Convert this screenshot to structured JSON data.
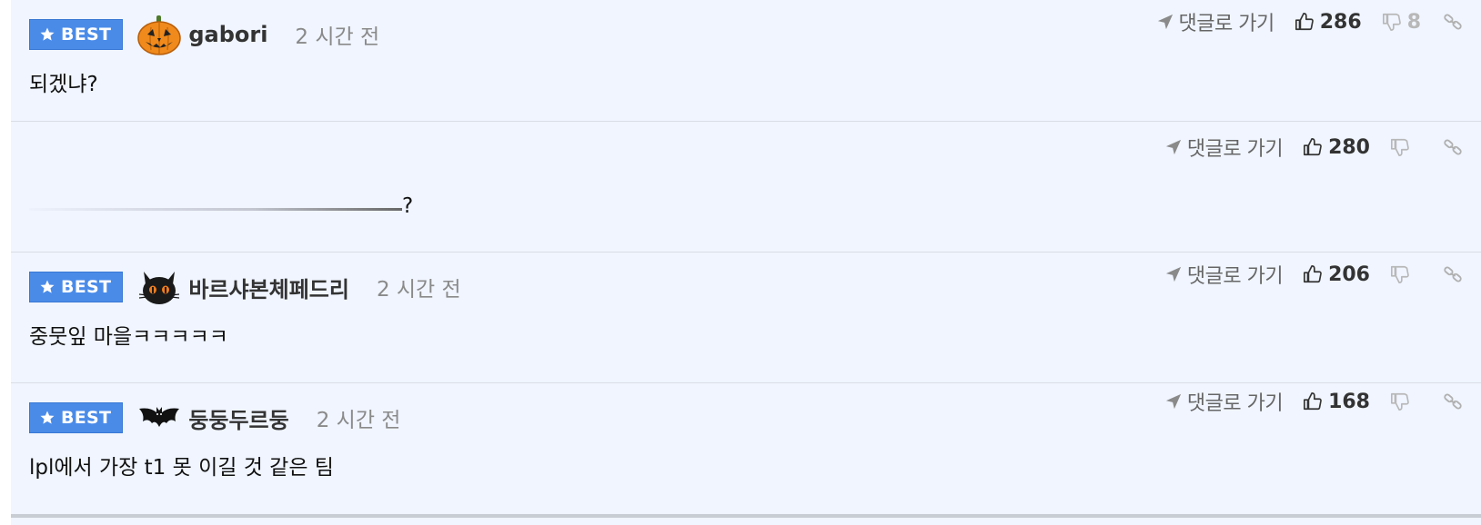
{
  "comments": [
    {
      "badge": "BEST",
      "avatar": "pumpkin-icon",
      "nickname": "gabori",
      "time": "2 시간 전",
      "text": "되겠냐?",
      "goto_label": "댓글로 가기",
      "likes": "286",
      "dislikes": "8"
    },
    {
      "text": "?",
      "goto_label": "댓글로 가기",
      "likes": "280",
      "dislikes": ""
    },
    {
      "badge": "BEST",
      "avatar": "black-cat-icon",
      "nickname": "바르샤본체페드리",
      "time": "2 시간 전",
      "text": "중뭇잎 마을ㅋㅋㅋㅋㅋ",
      "goto_label": "댓글로 가기",
      "likes": "206",
      "dislikes": ""
    },
    {
      "badge": "BEST",
      "avatar": "bat-icon",
      "nickname": "둥둥두르둥",
      "time": "2 시간 전",
      "text": "lpl에서 가장 t1 못 이길 것 같은 팀",
      "goto_label": "댓글로 가기",
      "likes": "168",
      "dislikes": ""
    }
  ],
  "colors": {
    "background": "#f0f5ff",
    "badge": "#4a8be8",
    "divider": "#d9dde5",
    "muted": "#8a8a8a"
  }
}
